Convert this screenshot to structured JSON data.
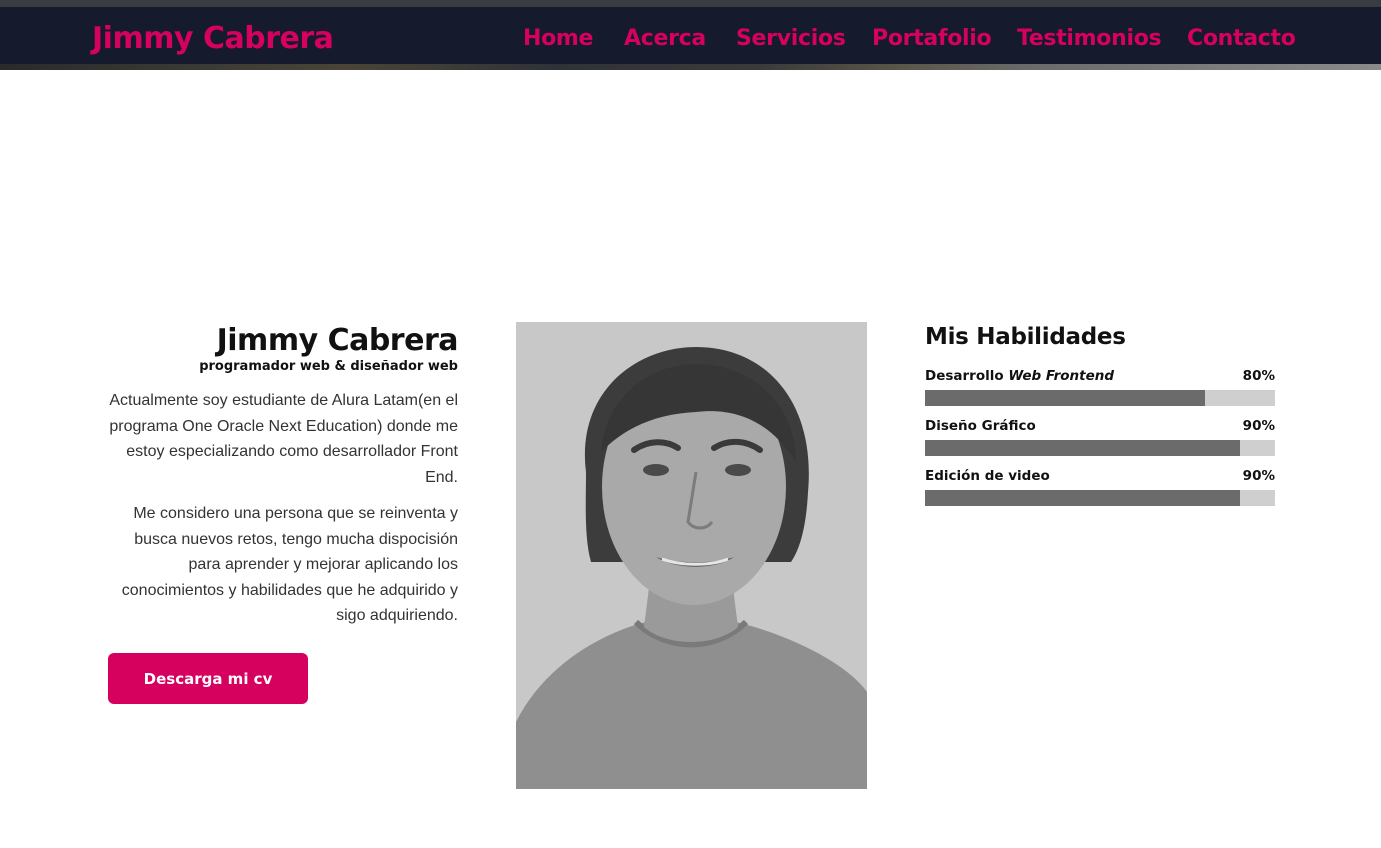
{
  "header": {
    "brand": "Jimmy Cabrera",
    "nav": [
      "Home",
      "Acerca",
      "Servicios",
      "Portafolio",
      "Testimonios",
      "Contacto"
    ]
  },
  "about": {
    "name": "Jimmy Cabrera",
    "subtitle": "programador web & diseñador web",
    "paragraphs": [
      "Actualmente soy estudiante de Alura Latam(en el programa One Oracle Next Education) donde me estoy especializando como desarrollador Front End.",
      "Me considero una persona que se reinventa y busca nuevos retos, tengo mucha dispocisión para aprender y mejorar aplicando los conocimientos y habilidades que he adquirido y sigo adquiriendo."
    ],
    "cv_button": "Descarga mi cv"
  },
  "skills": {
    "title": "Mis Habilidades",
    "items": [
      {
        "label": "Desarrollo",
        "label_em": "Web Frontend",
        "percent_label": "80%",
        "level": 0.8
      },
      {
        "label": "Diseño Gráfico",
        "label_em": "",
        "percent_label": "90%",
        "level": 0.9
      },
      {
        "label": "Edición de video",
        "label_em": "",
        "percent_label": "90%",
        "level": 0.9
      }
    ]
  },
  "colors": {
    "accent": "#d6005f",
    "header_bg": "#151a2d",
    "bar_fill": "#6b6b6b",
    "bar_track": "#cfcfcf"
  }
}
